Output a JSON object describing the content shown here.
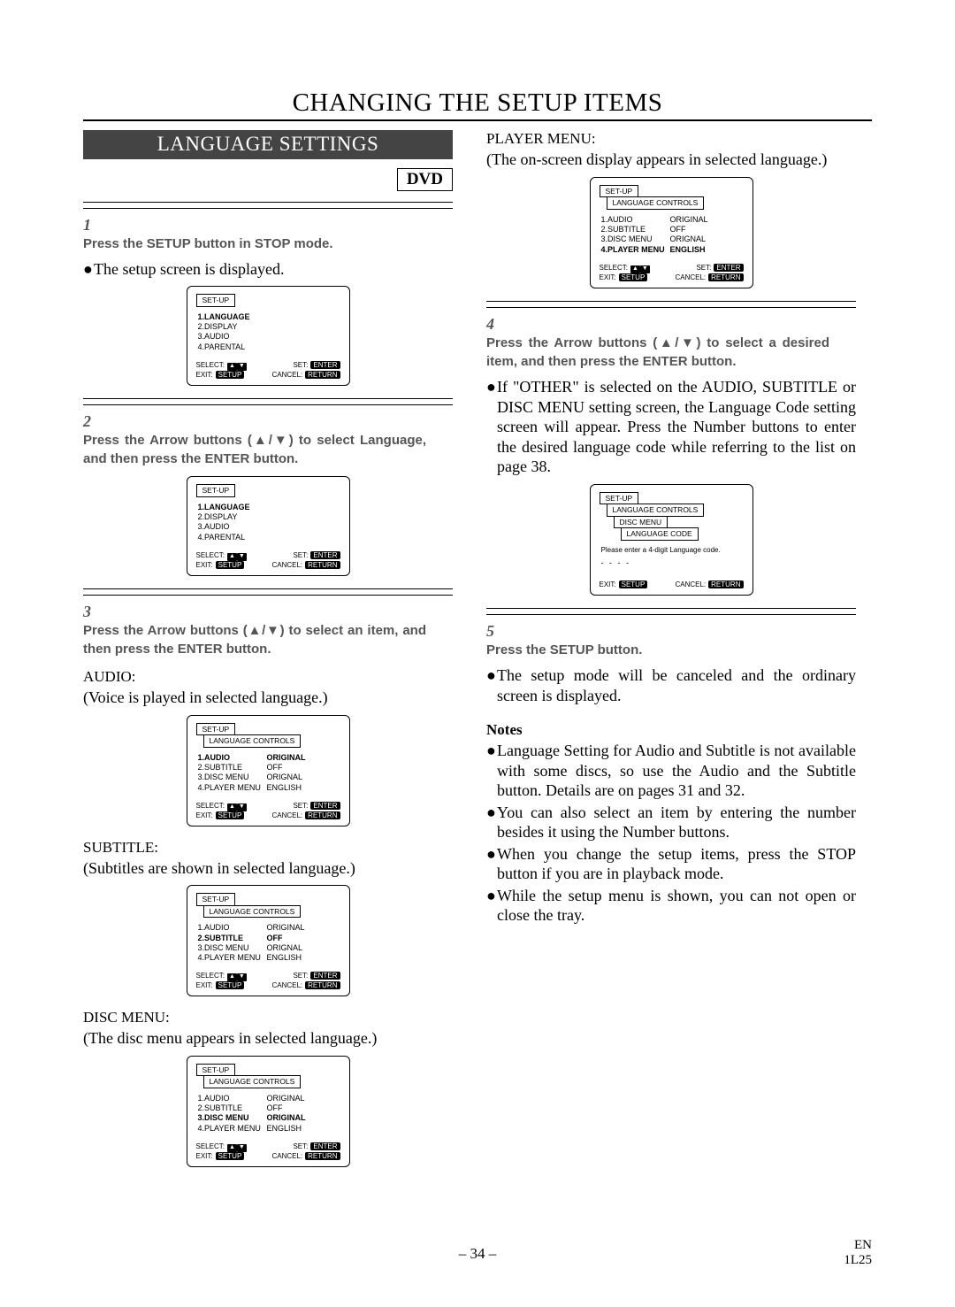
{
  "title": "CHANGING THE SETUP ITEMS",
  "section": "LANGUAGE SETTINGS",
  "badge": "DVD",
  "steps": {
    "s1": "Press the SETUP button in STOP mode.",
    "s1_body": "The setup screen is displayed.",
    "s2": "Press the Arrow buttons (▲/▼) to select Language, and then press the ENTER button.",
    "s3": "Press the Arrow buttons (▲/▼) to select an item, and then press the ENTER button.",
    "s4": "Press the Arrow buttons (▲/▼) to select a desired item, and then press the ENTER button.",
    "s4_body": "If \"OTHER\" is selected on the AUDIO, SUBTITLE or DISC MENU setting screen, the Language Code setting screen will appear. Press the Number buttons to enter the desired language code while referring to the list on page 38.",
    "s5": "Press the SETUP button.",
    "s5_body": "The setup mode will be canceled and the ordinary screen is displayed."
  },
  "audio": {
    "label": "AUDIO:",
    "desc": "(Voice is played in selected language.)"
  },
  "subtitle": {
    "label": "SUBTITLE:",
    "desc": "(Subtitles are shown in selected language.)"
  },
  "discmenu": {
    "label": "DISC MENU:",
    "desc": "(The disc menu appears in selected language.)"
  },
  "playermenu": {
    "label": "PLAYER MENU:",
    "desc": "(The on-screen display appears in selected language.)"
  },
  "notes_label": "Notes",
  "notes": [
    "Language Setting for Audio and Subtitle is not available with some discs, so use the Audio and the Subtitle button. Details are on pages 31 and 32.",
    "You can also select an item by entering the number besides it using the Number buttons.",
    "When you change the setup items, press the STOP button if you are in playback mode.",
    "While the setup menu is shown, you can not open or close the tray."
  ],
  "osd": {
    "setup": "SET-UP",
    "lang_controls": "LANGUAGE CONTROLS",
    "disc_menu": "DISC MENU",
    "lang_code": "LANGUAGE CODE",
    "main_items": [
      "1.LANGUAGE",
      "2.DISPLAY",
      "3.AUDIO",
      "4.PARENTAL"
    ],
    "lc_items": [
      {
        "l": "1.AUDIO",
        "r": "ORIGINAL"
      },
      {
        "l": "2.SUBTITLE",
        "r": "OFF"
      },
      {
        "l": "3.DISC MENU",
        "r": "ORIGNAL"
      },
      {
        "l": "4.PLAYER MENU",
        "r": "ENGLISH"
      }
    ],
    "lc_items_dm": [
      {
        "l": "1.AUDIO",
        "r": "ORIGINAL"
      },
      {
        "l": "2.SUBTITLE",
        "r": "OFF"
      },
      {
        "l": "3.DISC MENU",
        "r": "ORIGINAL"
      },
      {
        "l": "4.PLAYER MENU",
        "r": "ENGLISH"
      }
    ],
    "code_prompt": "Please enter a 4-digit Language code.",
    "dashes": "- - - -",
    "select": "SELECT:",
    "set": "SET:",
    "exit": "EXIT:",
    "cancel": "CANCEL:",
    "enter": "ENTER",
    "setup_pill": "SETUP",
    "return": "RETURN"
  },
  "footer": {
    "page": "– 34 –",
    "lang": "EN",
    "code": "1L25"
  }
}
